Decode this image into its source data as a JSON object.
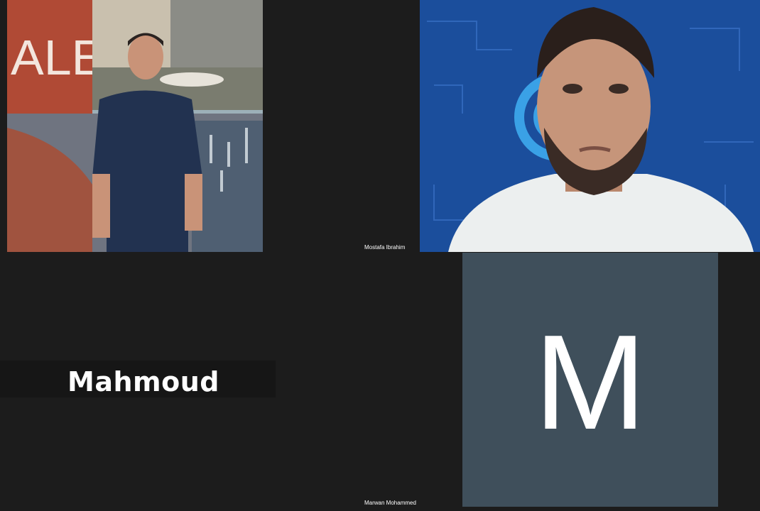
{
  "participants": [
    {
      "name": "Mostafa Ibrahim",
      "video": "photo"
    },
    {
      "name": "Mahmoud",
      "video": "camera"
    },
    {
      "name": "Marwan Mohammed",
      "video": "off",
      "avatar_letter": "M"
    }
  ],
  "colors": {
    "background": "#1c1c1c",
    "avatar_tile": "#3f4f5b",
    "banner": "#161616"
  }
}
